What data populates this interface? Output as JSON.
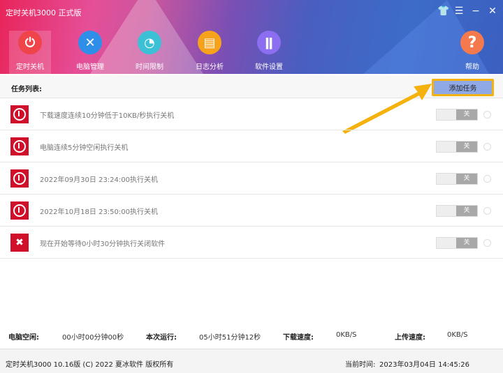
{
  "window": {
    "title": "定时关机3000 正式版",
    "controls": [
      "skin",
      "menu",
      "minimize",
      "close"
    ]
  },
  "nav": [
    {
      "label": "定时关机",
      "icon": "power-icon",
      "color": "#f0444b"
    },
    {
      "label": "电脑管理",
      "icon": "tools-icon",
      "color": "#2f8fe8"
    },
    {
      "label": "时间限制",
      "icon": "timer-icon",
      "color": "#3cc0d6"
    },
    {
      "label": "日志分析",
      "icon": "log-icon",
      "color": "#f6a21b"
    },
    {
      "label": "软件设置",
      "icon": "settings-icon",
      "color": "#8b6ff0"
    },
    {
      "label": "帮助",
      "icon": "help-icon",
      "color": "#f47a4e"
    }
  ],
  "list": {
    "title": "任务列表:",
    "add_button": "添加任务"
  },
  "tasks": [
    {
      "text": "下载速度连续10分钟低于10KB/秒执行关机",
      "toggle": "关",
      "type": "shutdown"
    },
    {
      "text": "电脑连续5分钟空闲执行关机",
      "toggle": "关",
      "type": "shutdown"
    },
    {
      "text": "2022年09月30日 23:24:00执行关机",
      "toggle": "关",
      "type": "shutdown"
    },
    {
      "text": "2022年10月18日 23:50:00执行关机",
      "toggle": "关",
      "type": "shutdown"
    },
    {
      "text": "现在开始等待0小时30分钟执行关闭软件",
      "toggle": "关",
      "type": "close-app"
    }
  ],
  "stats": {
    "idle_label": "电脑空闲:",
    "idle_value": "00小时00分钟00秒",
    "run_label": "本次运行:",
    "run_value": "05小时51分钟12秒",
    "down_label": "下载速度:",
    "down_value": "0KB/S",
    "up_label": "上传速度:",
    "up_value": "0KB/S"
  },
  "footer": {
    "copyright": "定时关机3000 10.16版 (C) 2022  夏冰软件 版权所有",
    "time_label": "当前时间:",
    "time_value": "2023年03月04日 14:45:26"
  },
  "colors": {
    "accent": "#f5b10e",
    "button": "#8fa8e6",
    "task_icon": "#d0102a"
  }
}
